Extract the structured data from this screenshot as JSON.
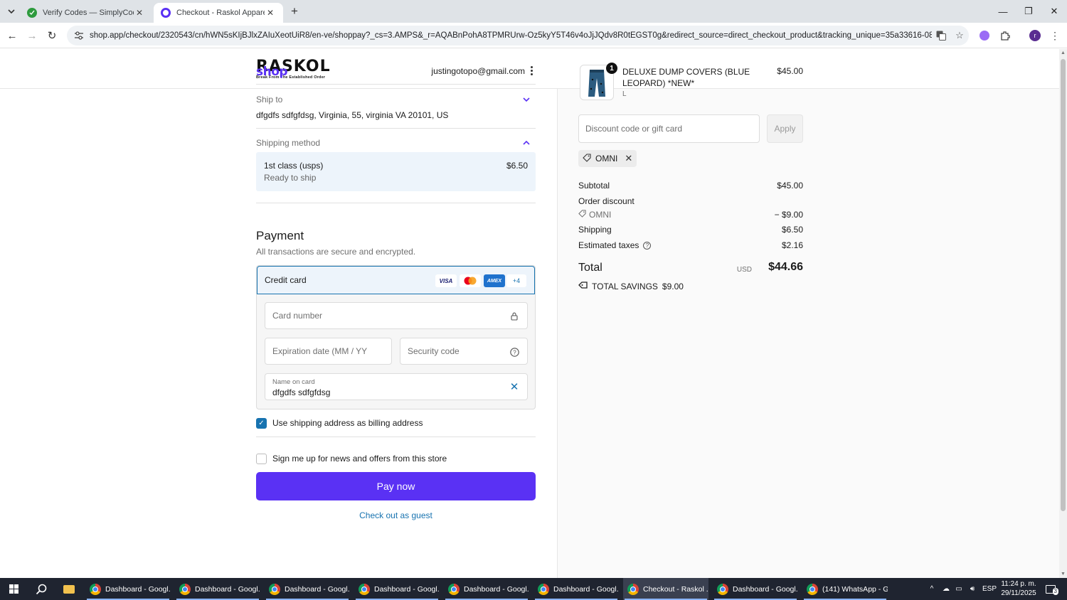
{
  "browser": {
    "tabs": [
      {
        "title": "Verify Codes — SimplyCodes",
        "active": false
      },
      {
        "title": "Checkout - Raskol Apparel",
        "active": true
      }
    ],
    "url": "shop.app/checkout/2320543/cn/hWN5sKIjBJlxZAIuXeotUiR8/en-ve/shoppay?_cs=3.AMPS&_r=AQABnPohA8TPMRUrw-Oz5kyY5T46v4oJjJQdv8R0tEGST0g&redirect_source=direct_checkout_product&tracking_unique=35a33616-08d5-4321-9435..."
  },
  "store": {
    "logo_text": "RASKOL",
    "logo_tagline": "Break From The Established Order"
  },
  "shop": {
    "logo": "shop",
    "email": "justingotopo@gmail.com"
  },
  "ship_to": {
    "label": "Ship to",
    "address": "dfgdfs sdfgfdsg, Virginia, 55, virginia VA 20101, US"
  },
  "shipping_method": {
    "label": "Shipping method",
    "name": "1st class (usps)",
    "status": "Ready to ship",
    "price": "$6.50"
  },
  "payment": {
    "title": "Payment",
    "subtitle": "All transactions are secure and encrypted.",
    "method_label": "Credit card",
    "cards": [
      "VISA",
      "MC",
      "AMEX"
    ],
    "more_cards": "+4",
    "card_number_placeholder": "Card number",
    "expiry_placeholder": "Expiration date (MM / YY)",
    "security_placeholder": "Security code",
    "name_label": "Name on card",
    "name_value": "dfgdfs sdfgfdsg"
  },
  "options": {
    "billing_same": "Use shipping address as billing address",
    "newsletter": "Sign me up for news and offers from this store"
  },
  "actions": {
    "pay_now": "Pay now",
    "guest": "Check out as guest"
  },
  "order": {
    "product_name": "DELUXE DUMP COVERS (BLUE LEOPARD) *NEW*",
    "variant": "L",
    "quantity": "1",
    "price": "$45.00",
    "discount_placeholder": "Discount code or gift card",
    "apply": "Apply",
    "applied_code": "OMNI",
    "subtotal_label": "Subtotal",
    "subtotal": "$45.00",
    "order_discount_label": "Order discount",
    "discount_code_line": "OMNI",
    "discount_amount": "− $9.00",
    "shipping_label": "Shipping",
    "shipping": "$6.50",
    "taxes_label": "Estimated taxes",
    "taxes": "$2.16",
    "total_label": "Total",
    "currency": "USD",
    "total": "$44.66",
    "savings_label": "TOTAL SAVINGS",
    "savings": "$9.00"
  },
  "taskbar": {
    "items": [
      "Dashboard - Googl...",
      "Dashboard - Googl...",
      "Dashboard - Googl...",
      "Dashboard - Googl...",
      "Dashboard - Googl...",
      "Dashboard - Googl...",
      "Checkout - Raskol ...",
      "Dashboard - Googl...",
      "(141) WhatsApp - G..."
    ],
    "language": "ESP",
    "time": "11:24 p. m.",
    "date": "29/11/2025",
    "notifications": "3"
  },
  "colors": {
    "shop_purple": "#5a31f4",
    "link_blue": "#1773b0",
    "selected_bg": "#edf4fb"
  }
}
